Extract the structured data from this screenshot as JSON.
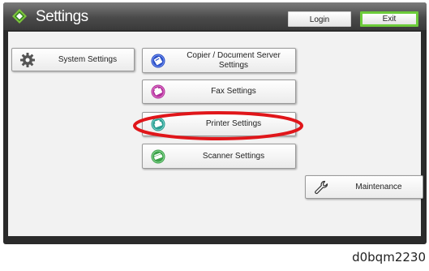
{
  "header": {
    "title": "Settings",
    "login_label": "Login",
    "exit_label": "Exit"
  },
  "buttons": {
    "system_settings": "System Settings",
    "copier_settings": "Copier / Document Server Settings",
    "fax_settings": "Fax Settings",
    "printer_settings": "Printer Settings",
    "scanner_settings": "Scanner Settings",
    "maintenance": "Maintenance"
  },
  "icons": {
    "settings": "diamond-arrows-icon",
    "system": "gear-icon",
    "copier": "copier-icon",
    "fax": "fax-icon",
    "printer": "printer-icon",
    "scanner": "scanner-icon",
    "maintenance": "wrench-icon"
  },
  "colors": {
    "copier_icon": "#2a4fc4",
    "fax_icon": "#b0309a",
    "printer_icon": "#2a9c90",
    "scanner_icon": "#3ca04a",
    "highlight_ring": "#e0161a",
    "exit_border": "#6ccb3a"
  },
  "caption": "d0bqm2230"
}
